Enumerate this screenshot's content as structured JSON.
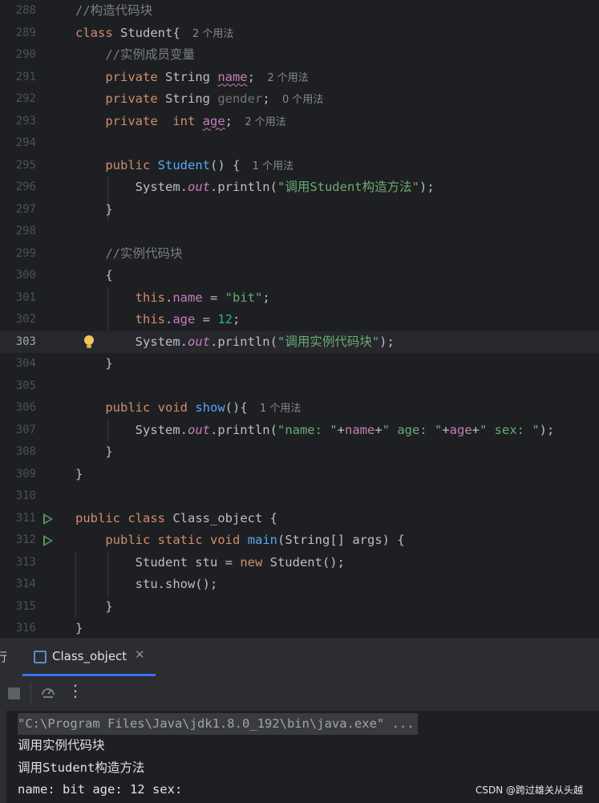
{
  "editor": {
    "lines": [
      {
        "num": "288",
        "parts": [
          {
            "t": "//构造代码块",
            "c": "cm"
          }
        ]
      },
      {
        "num": "289",
        "parts": [
          {
            "t": "class",
            "c": "kw"
          },
          {
            "t": " Student{ "
          },
          {
            "t": "2 个用法",
            "c": "hint"
          }
        ]
      },
      {
        "num": "290",
        "parts": [
          {
            "t": "    "
          },
          {
            "t": "//实例成员变量",
            "c": "cm"
          }
        ]
      },
      {
        "num": "291",
        "parts": [
          {
            "t": "    "
          },
          {
            "t": "private",
            "c": "kw"
          },
          {
            "t": " String "
          },
          {
            "t": "name",
            "c": "fld uline"
          },
          {
            "t": "; "
          },
          {
            "t": "2 个用法",
            "c": "hint"
          }
        ]
      },
      {
        "num": "292",
        "parts": [
          {
            "t": "    "
          },
          {
            "t": "private",
            "c": "kw"
          },
          {
            "t": " String "
          },
          {
            "t": "gender",
            "c": "unused"
          },
          {
            "t": "; "
          },
          {
            "t": "0 个用法",
            "c": "hint"
          }
        ]
      },
      {
        "num": "293",
        "parts": [
          {
            "t": "    "
          },
          {
            "t": "private",
            "c": "kw"
          },
          {
            "t": "  "
          },
          {
            "t": "int",
            "c": "kw"
          },
          {
            "t": " "
          },
          {
            "t": "age",
            "c": "fld uline"
          },
          {
            "t": "; "
          },
          {
            "t": "2 个用法",
            "c": "hint"
          }
        ]
      },
      {
        "num": "294",
        "parts": []
      },
      {
        "num": "295",
        "parts": [
          {
            "t": "    "
          },
          {
            "t": "public",
            "c": "kw"
          },
          {
            "t": " "
          },
          {
            "t": "Student",
            "c": "fn"
          },
          {
            "t": "() { "
          },
          {
            "t": "1 个用法",
            "c": "hint"
          }
        ]
      },
      {
        "num": "296",
        "parts": [
          {
            "t": "        System."
          },
          {
            "t": "out",
            "c": "static"
          },
          {
            "t": ".println("
          },
          {
            "t": "\"调用Student构造方法\"",
            "c": "str"
          },
          {
            "t": ");"
          }
        ]
      },
      {
        "num": "297",
        "parts": [
          {
            "t": "    }"
          }
        ]
      },
      {
        "num": "298",
        "parts": []
      },
      {
        "num": "299",
        "parts": [
          {
            "t": "    "
          },
          {
            "t": "//实例代码块",
            "c": "cm"
          }
        ]
      },
      {
        "num": "300",
        "parts": [
          {
            "t": "    {"
          }
        ]
      },
      {
        "num": "301",
        "parts": [
          {
            "t": "        "
          },
          {
            "t": "this",
            "c": "kw"
          },
          {
            "t": "."
          },
          {
            "t": "name",
            "c": "fld"
          },
          {
            "t": " = "
          },
          {
            "t": "\"bit\"",
            "c": "str"
          },
          {
            "t": ";"
          }
        ]
      },
      {
        "num": "302",
        "parts": [
          {
            "t": "        "
          },
          {
            "t": "this",
            "c": "kw"
          },
          {
            "t": "."
          },
          {
            "t": "age",
            "c": "fld"
          },
          {
            "t": " = "
          },
          {
            "t": "12",
            "c": "num"
          },
          {
            "t": ";"
          }
        ]
      },
      {
        "num": "303",
        "parts": [
          {
            "t": "        System."
          },
          {
            "t": "out",
            "c": "static"
          },
          {
            "t": ".println("
          },
          {
            "t": "\"调用实例代码块\"",
            "c": "str"
          },
          {
            "t": ");"
          }
        ]
      },
      {
        "num": "304",
        "parts": [
          {
            "t": "    }"
          }
        ]
      },
      {
        "num": "305",
        "parts": []
      },
      {
        "num": "306",
        "parts": [
          {
            "t": "    "
          },
          {
            "t": "public",
            "c": "kw"
          },
          {
            "t": " "
          },
          {
            "t": "void",
            "c": "kw"
          },
          {
            "t": " "
          },
          {
            "t": "show",
            "c": "fn"
          },
          {
            "t": "(){ "
          },
          {
            "t": "1 个用法",
            "c": "hint"
          }
        ]
      },
      {
        "num": "307",
        "parts": [
          {
            "t": "        System."
          },
          {
            "t": "out",
            "c": "static"
          },
          {
            "t": ".println("
          },
          {
            "t": "\"name: \"",
            "c": "str"
          },
          {
            "t": "+"
          },
          {
            "t": "name",
            "c": "fld"
          },
          {
            "t": "+"
          },
          {
            "t": "\" age: \"",
            "c": "str"
          },
          {
            "t": "+"
          },
          {
            "t": "age",
            "c": "fld"
          },
          {
            "t": "+"
          },
          {
            "t": "\" sex: \"",
            "c": "str"
          },
          {
            "t": ");"
          }
        ]
      },
      {
        "num": "308",
        "parts": [
          {
            "t": "    }"
          }
        ]
      },
      {
        "num": "309",
        "parts": [
          {
            "t": "}"
          }
        ]
      },
      {
        "num": "310",
        "parts": []
      },
      {
        "num": "311",
        "parts": [
          {
            "t": "public",
            "c": "kw"
          },
          {
            "t": " "
          },
          {
            "t": "class",
            "c": "kw"
          },
          {
            "t": " Class_object {"
          }
        ]
      },
      {
        "num": "312",
        "parts": [
          {
            "t": "    "
          },
          {
            "t": "public",
            "c": "kw"
          },
          {
            "t": " "
          },
          {
            "t": "static",
            "c": "kw"
          },
          {
            "t": " "
          },
          {
            "t": "void",
            "c": "kw"
          },
          {
            "t": " "
          },
          {
            "t": "main",
            "c": "fn"
          },
          {
            "t": "(String[] args) {"
          }
        ]
      },
      {
        "num": "313",
        "parts": [
          {
            "t": "        Student stu = "
          },
          {
            "t": "new",
            "c": "kw"
          },
          {
            "t": " Student();"
          }
        ]
      },
      {
        "num": "314",
        "parts": [
          {
            "t": "        stu.show();"
          }
        ]
      },
      {
        "num": "315",
        "parts": [
          {
            "t": "    }"
          }
        ]
      },
      {
        "num": "316",
        "parts": [
          {
            "t": "}"
          }
        ]
      }
    ],
    "current_line": "303",
    "run_lines": [
      "311",
      "312"
    ],
    "bulb_line": "303",
    "icons": {
      "run": "run-gutter-icon",
      "bulb": "intention-bulb-icon"
    },
    "colors": {
      "keyword": "#cf8e6d",
      "comment": "#7a7e85",
      "string": "#6aab73",
      "number": "#2aacb8",
      "field": "#c77dbb",
      "function": "#56a8f5"
    }
  },
  "toolwindow": {
    "left_cut_label": "行",
    "tab_label": "Class_object",
    "tab_close": "✕",
    "more": "⋮",
    "icons": {
      "stop": "stop-icon",
      "gauge": "profiler-gauge-icon",
      "more": "more-vertical-icon",
      "tab": "run-config-icon",
      "close": "close-icon"
    }
  },
  "console": {
    "lines": [
      "\"C:\\Program Files\\Java\\jdk1.8.0_192\\bin\\java.exe\" ...",
      "调用实例代码块",
      "调用Student构造方法",
      "name: bit age: 12 sex: "
    ]
  },
  "watermark": "CSDN @跨过雄关从头越"
}
